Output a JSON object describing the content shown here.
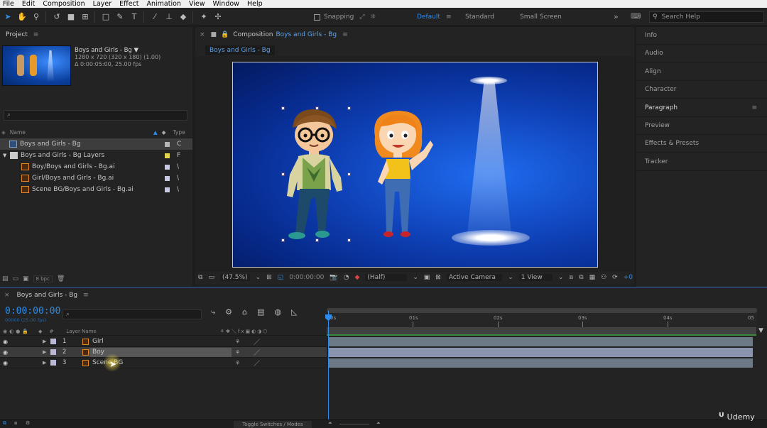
{
  "menu": [
    "File",
    "Edit",
    "Composition",
    "Layer",
    "Effect",
    "Animation",
    "View",
    "Window",
    "Help"
  ],
  "toolbar": {
    "snapping_label": "Snapping",
    "workspaces": [
      "Default",
      "Standard",
      "Small Screen"
    ],
    "search_placeholder": "Search Help"
  },
  "project": {
    "tab_label": "Project",
    "comp_name": "Boys and Girls - Bg",
    "comp_size": "1280 x 720  (320 x 180) (1.00)",
    "comp_duration": "Δ 0:00:05:00, 25.00 fps",
    "search_icon": "⌕",
    "col_name": "Name",
    "col_type": "Type",
    "items": [
      {
        "name": "Boys and Girls - Bg",
        "type": "C",
        "swatch": "#b5b5b5"
      },
      {
        "name": "Boys and Girls - Bg Layers",
        "type": "F",
        "swatch": "#e0d74a"
      },
      {
        "name": "Boy/Boys and Girls - Bg.ai",
        "type": "\\",
        "swatch": "#c9c9e0"
      },
      {
        "name": "Girl/Boys and Girls - Bg.ai",
        "type": "\\",
        "swatch": "#c9c9e0"
      },
      {
        "name": "Scene BG/Boys and Girls - Bg.ai",
        "type": "\\",
        "swatch": "#c9c9e0"
      }
    ],
    "bpc": "8 bpc"
  },
  "composition": {
    "tab_prefix": "Composition",
    "tab_name": "Boys and Girls - Bg",
    "breadcrumb": "Boys and Girls - Bg",
    "zoom": "(47.5%)",
    "timecode": "0:00:00:00",
    "resolution": "(Half)",
    "camera": "Active Camera",
    "views": "1 View",
    "exposure": "+0"
  },
  "right_panels": [
    "Info",
    "Audio",
    "Align",
    "Character",
    "Paragraph",
    "Preview",
    "Effects & Presets",
    "Tracker"
  ],
  "timeline": {
    "tab_label": "Boys and Girls - Bg",
    "current_time": "0:00:00:00",
    "frame_info": "00000 (25.00 fps)",
    "search_icon": "⌕",
    "col_hash": "#",
    "col_layer_name": "Layer Name",
    "ruler_ticks": [
      "0s",
      "01s",
      "02s",
      "03s",
      "04s",
      "05"
    ],
    "layers": [
      {
        "num": "1",
        "name": "Girl",
        "bar_color": "#6c7a88"
      },
      {
        "num": "2",
        "name": "Boy",
        "bar_color": "#8a94ae"
      },
      {
        "num": "3",
        "name": "Scene BG",
        "bar_color": "#6c7a88"
      }
    ],
    "toggle_label": "Toggle Switches / Modes"
  },
  "watermark": "Udemy"
}
